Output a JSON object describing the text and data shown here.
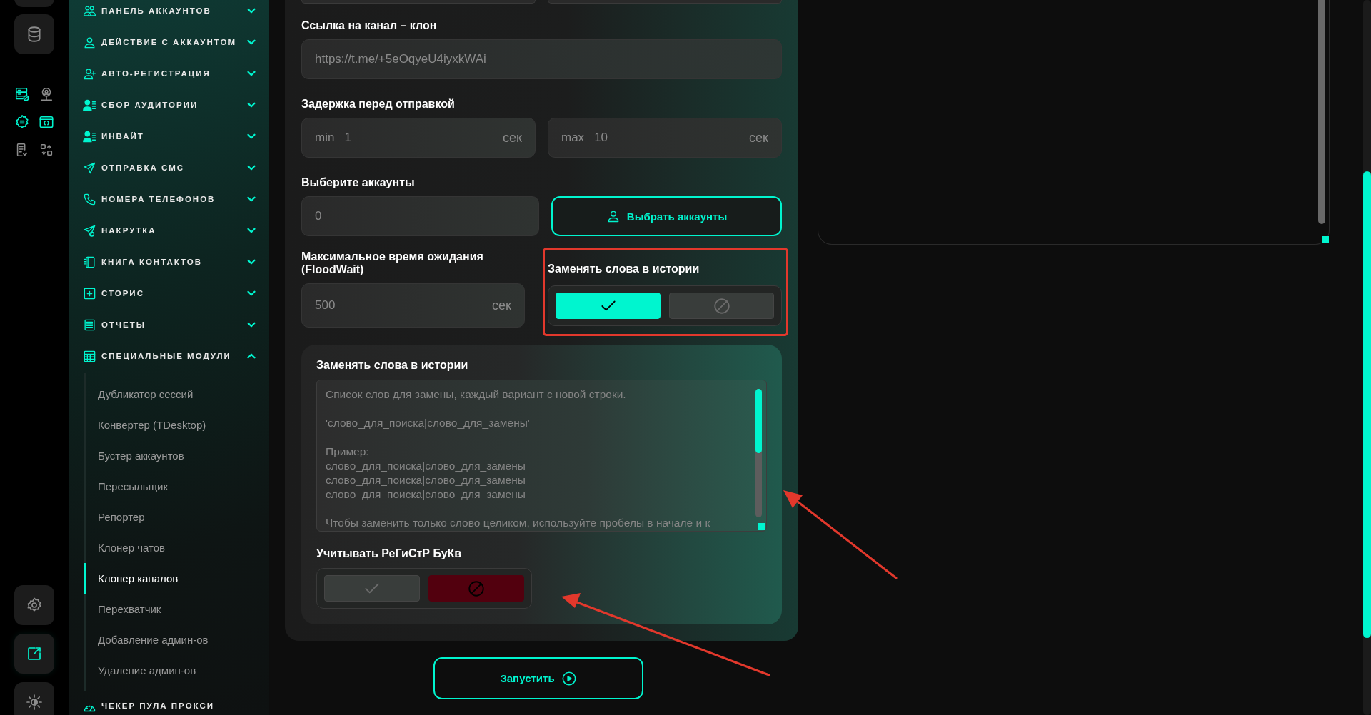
{
  "sidebar": {
    "items": [
      {
        "label": "ПАНЕЛЬ АККАУНТОВ",
        "expanded": false
      },
      {
        "label": "ДЕЙСТВИЕ С АККАУНТОМ",
        "expanded": false
      },
      {
        "label": "АВТО-РЕГИСТРАЦИЯ",
        "expanded": false
      },
      {
        "label": "СБОР АУДИТОРИИ",
        "expanded": false
      },
      {
        "label": "ИНВАЙТ",
        "expanded": false
      },
      {
        "label": "ОТПРАВКА СМС",
        "expanded": false
      },
      {
        "label": "НОМЕРА ТЕЛЕФОНОВ",
        "expanded": false
      },
      {
        "label": "НАКРУТКА",
        "expanded": false
      },
      {
        "label": "КНИГА КОНТАКТОВ",
        "expanded": false
      },
      {
        "label": "СТОРИС",
        "expanded": false
      },
      {
        "label": "ОТЧЕТЫ",
        "expanded": false
      },
      {
        "label": "СПЕЦИАЛЬНЫЕ МОДУЛИ",
        "expanded": true,
        "children": [
          {
            "label": "Дубликатор сессий",
            "selected": false
          },
          {
            "label": "Конвертер (TDesktop)",
            "selected": false
          },
          {
            "label": "Бустер аккаунтов",
            "selected": false
          },
          {
            "label": "Пересыльщик",
            "selected": false
          },
          {
            "label": "Репортер",
            "selected": false
          },
          {
            "label": "Клонер чатов",
            "selected": false
          },
          {
            "label": "Клонер каналов",
            "selected": true
          },
          {
            "label": "Перехватчик",
            "selected": false
          },
          {
            "label": "Добавление админ-ов",
            "selected": false
          },
          {
            "label": "Удаление админ-ов",
            "selected": false
          }
        ]
      },
      {
        "label": "ЧЕКЕР ПУЛА ПРОКСИ"
      }
    ]
  },
  "form": {
    "channel_link": {
      "label": "Ссылка на канал – клон",
      "value": "https://t.me/+5eOqyeU4iyxkWAi"
    },
    "delay": {
      "label": "Задержка перед отправкой",
      "fields": [
        {
          "prefix": "min",
          "value": "1",
          "unit": "сек"
        },
        {
          "prefix": "max",
          "value": "10",
          "unit": "сек"
        }
      ]
    },
    "accounts": {
      "label": "Выберите аккаунты",
      "value": "0",
      "button": "Выбрать аккаунты"
    },
    "floodwait": {
      "label": "Максимальное время ожидания (FloodWait)",
      "value": "500",
      "unit": "сек"
    },
    "replace_toggle": {
      "label": "Заменять слова в истории",
      "options": [
        {
          "kind": "check",
          "selected": true
        },
        {
          "kind": "ban",
          "selected": false
        }
      ]
    },
    "replace_card": {
      "label": "Заменять слова в истории",
      "placeholder": "Список слов для замены, каждый вариант с новой строки.\n\n'слово_для_поиска|слово_для_замены'\n\nПример:\nслово_для_поиска|слово_для_замены\nслово_для_поиска|слово_для_замены\nслово_для_поиска|слово_для_замены\n\nЧтобы заменить только слово целиком, используйте пробелы в начале и к",
      "case_toggle": {
        "label": "Учитывать РеГиСтР БуКв",
        "options": [
          {
            "kind": "check",
            "selected": false
          },
          {
            "kind": "ban",
            "selected": true
          }
        ]
      }
    }
  },
  "run_button": {
    "label": "Запустить"
  }
}
